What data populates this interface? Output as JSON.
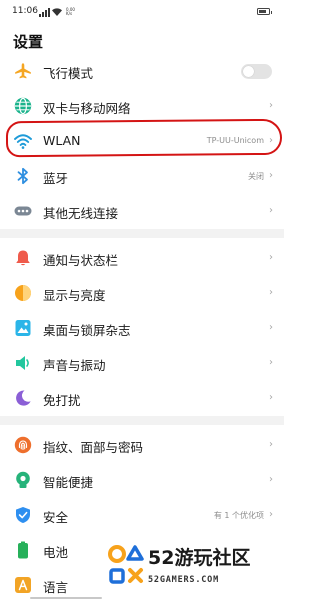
{
  "status": {
    "time": "11:06",
    "speed": "0.00\nK/s"
  },
  "header": {
    "title": "设置"
  },
  "groups": [
    {
      "items": [
        {
          "label": "飞行模式",
          "icon": "airplane-icon",
          "toggle": false
        },
        {
          "label": "双卡与移动网络",
          "icon": "globe-icon"
        },
        {
          "label": "WLAN",
          "icon": "wifi-icon",
          "value": "TP-UU-Unicom"
        },
        {
          "label": "蓝牙",
          "icon": "bluetooth-icon",
          "value": "关闭"
        },
        {
          "label": "其他无线连接",
          "icon": "more-connections-icon"
        }
      ]
    },
    {
      "items": [
        {
          "label": "通知与状态栏",
          "icon": "bell-icon"
        },
        {
          "label": "显示与亮度",
          "icon": "brightness-icon"
        },
        {
          "label": "桌面与锁屏杂志",
          "icon": "wallpaper-icon"
        },
        {
          "label": "声音与振动",
          "icon": "sound-icon"
        },
        {
          "label": "免打扰",
          "icon": "moon-icon"
        }
      ]
    },
    {
      "items": [
        {
          "label": "指纹、面部与密码",
          "icon": "fingerprint-icon"
        },
        {
          "label": "智能便捷",
          "icon": "smart-assist-icon"
        },
        {
          "label": "安全",
          "icon": "shield-icon",
          "value": "有 1 个优化项"
        },
        {
          "label": "电池",
          "icon": "battery-icon"
        },
        {
          "label": "语言",
          "icon": "language-icon"
        }
      ]
    }
  ],
  "chevron": "›",
  "watermark": {
    "title": "52游玩社区",
    "subtitle": "52GAMERS.COM"
  },
  "colors": {
    "airplane": "#f5a623",
    "globe": "#1ab38c",
    "wifi": "#1e9bd8",
    "bluetooth": "#2f8fe0",
    "more": "#7b8794",
    "bell": "#ef5b4c",
    "brightness": "#f7a21b",
    "wallpaper": "#2bb5e8",
    "sound": "#22c79e",
    "moon": "#8b5fd6",
    "fingerprint": "#ee6f2d",
    "smart": "#26b37a",
    "shield": "#2e8ff0",
    "battery": "#27b05a",
    "language": "#f2a425",
    "highlight": "#d41414"
  }
}
